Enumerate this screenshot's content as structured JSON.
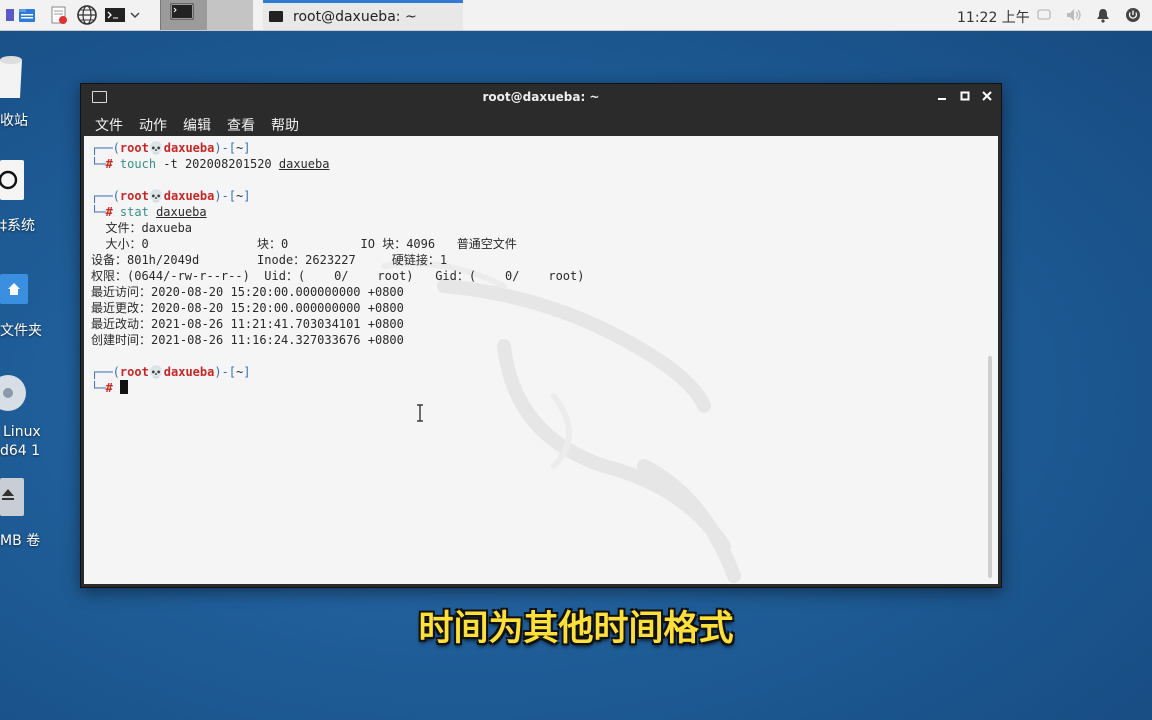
{
  "panel": {
    "window_button_title": "root@daxueba: ~",
    "clock": "11:22 上午"
  },
  "desktop": {
    "icons": [
      {
        "label": "收站",
        "icon": "trash-icon"
      },
      {
        "label": "‡系统",
        "icon": "filesystem-icon"
      },
      {
        "label": "文件夹",
        "icon": "home-folder-icon"
      },
      {
        "label": "Linux",
        "label2": "d64 1",
        "icon": "disc-icon"
      },
      {
        "label": "MB 卷",
        "icon": "drive-icon"
      }
    ]
  },
  "window": {
    "title": "root@daxueba: ~",
    "menu": [
      "文件",
      "动作",
      "编辑",
      "查看",
      "帮助"
    ]
  },
  "terminal": {
    "user": "root",
    "host": "daxueba",
    "dir": "~",
    "cmd1": "touch",
    "cmd1_args": " -t 202008201520 ",
    "cmd1_file": "daxueba",
    "cmd2": "stat",
    "cmd2_file": "daxueba",
    "stat_lines": [
      "  文件：daxueba",
      "  大小：0               块：0          IO 块：4096   普通空文件",
      "设备：801h/2049d        Inode：2623227     硬链接：1",
      "权限：(0644/-rw-r--r--)  Uid：(    0/    root)   Gid：(    0/    root)",
      "最近访问：2020-08-20 15:20:00.000000000 +0800",
      "最近更改：2020-08-20 15:20:00.000000000 +0800",
      "最近改动：2021-08-26 11:21:41.703034101 +0800",
      "创建时间：2021-08-26 11:16:24.327033676 +0800"
    ]
  },
  "subtitle": "时间为其他时间格式",
  "colors": {
    "accent": "#2f7bd6",
    "prompt_blue": "#3a6fb3",
    "prompt_red": "#c62828",
    "subtitle_yellow": "#ffe03a"
  }
}
